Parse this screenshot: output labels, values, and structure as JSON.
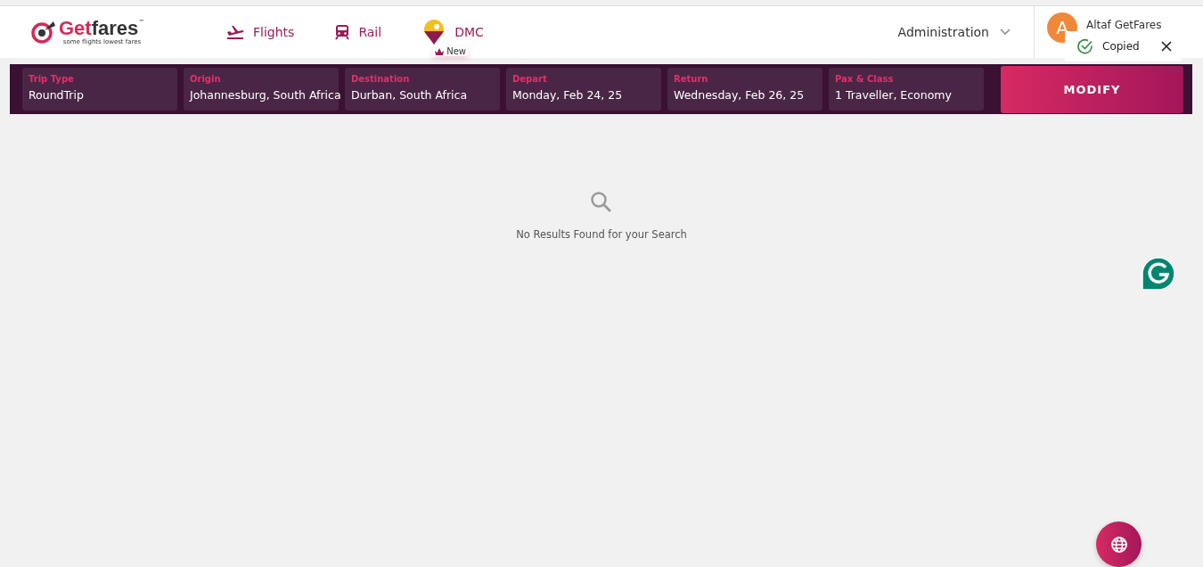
{
  "logo": {
    "brand_first": "Get",
    "brand_rest": "fares",
    "trademark": "™",
    "tagline": "some flights lowest fares"
  },
  "nav": [
    {
      "label": "Flights",
      "kind": "plane"
    },
    {
      "label": "Rail",
      "kind": "train"
    },
    {
      "label": "DMC",
      "kind": "pin",
      "badge": "New"
    }
  ],
  "admin_menu": {
    "label": "Administration"
  },
  "user": {
    "initial": "A",
    "name": "Altaf GetFares"
  },
  "toast": {
    "message": "Copied"
  },
  "search_bar": {
    "fields": [
      {
        "label": "Trip Type",
        "value": "RoundTrip"
      },
      {
        "label": "Origin",
        "value": "Johannesburg, South Africa"
      },
      {
        "label": "Destination",
        "value": "Durban, South Africa"
      },
      {
        "label": "Depart",
        "value": "Monday, Feb 24, 25"
      },
      {
        "label": "Return",
        "value": "Wednesday, Feb 26, 25"
      },
      {
        "label": "Pax & Class",
        "value": "1 Traveller, Economy"
      }
    ],
    "button": "MODIFY"
  },
  "empty_state": {
    "message": "No Results Found for your Search"
  }
}
